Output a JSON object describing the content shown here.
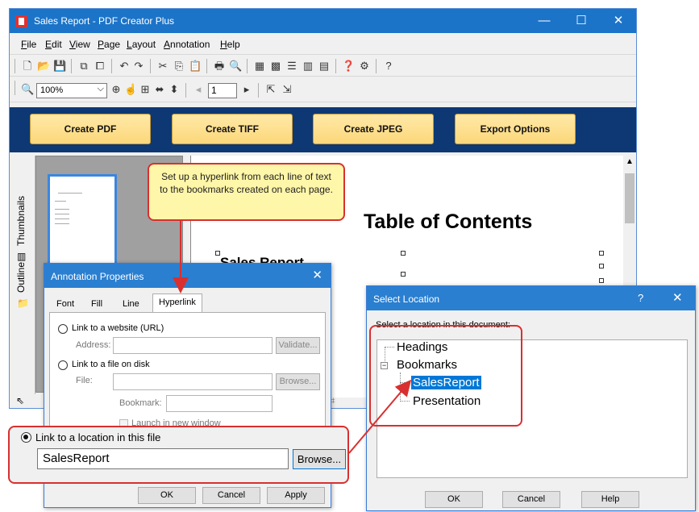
{
  "window": {
    "title": "Sales Report - PDF Creator Plus",
    "minimize": "—",
    "maximize": "☐",
    "close": "✕"
  },
  "menu": [
    {
      "label": "File",
      "u": "F",
      "rest": "ile"
    },
    {
      "label": "Edit",
      "u": "E",
      "rest": "dit"
    },
    {
      "label": "View",
      "u": "V",
      "rest": "iew"
    },
    {
      "label": "Page",
      "u": "P",
      "rest": "age"
    },
    {
      "label": "Layout",
      "u": "L",
      "rest": "ayout"
    },
    {
      "label": "Annotation",
      "u": "A",
      "rest": "nnotation"
    },
    {
      "label": "Help",
      "u": "H",
      "rest": "elp"
    }
  ],
  "toolbar2": {
    "zoom": "100%",
    "page": "1"
  },
  "action_buttons": {
    "create_pdf": "Create PDF",
    "create_tiff": "Create TIFF",
    "create_jpeg": "Create JPEG",
    "export_options": "Export Options"
  },
  "side_tabs": {
    "thumbnails": "Thumbnails",
    "outline": "Outline"
  },
  "document": {
    "heading": "Table of Contents",
    "subheading": "Sales Report"
  },
  "callout": {
    "text": "Set up a hyperlink from each line of text to the bookmarks created on each page."
  },
  "annotation_dialog": {
    "title": "Annotation Properties",
    "close": "✕",
    "tabs": [
      "Font",
      "Fill",
      "Line",
      "Hyperlink"
    ],
    "option_website": "Link to a website (URL)",
    "address_label": "Address:",
    "validate": "Validate...",
    "option_file": "Link to a file on disk",
    "file_label": "File:",
    "browse_file": "Browse...",
    "bookmark_label": "Bookmark:",
    "launch_new_window": "Launch in new window",
    "ok": "OK",
    "cancel": "Cancel",
    "apply": "Apply"
  },
  "link_location": {
    "label": "Link to a location in this file",
    "value": "SalesReport",
    "browse": "Browse..."
  },
  "location_dialog": {
    "title": "Select Location",
    "help": "?",
    "close": "✕",
    "prompt": "Select a location in this document:",
    "tree": {
      "headings": "Headings",
      "bookmarks": "Bookmarks",
      "children": [
        "SalesReport",
        "Presentation"
      ]
    },
    "ok": "OK",
    "cancel": "Cancel",
    "help_button": "Help"
  },
  "colors": {
    "titlebar": "#1c74c8",
    "button_band": "#0d3873",
    "callout_border": "#d83030",
    "selection": "#0078d7"
  }
}
